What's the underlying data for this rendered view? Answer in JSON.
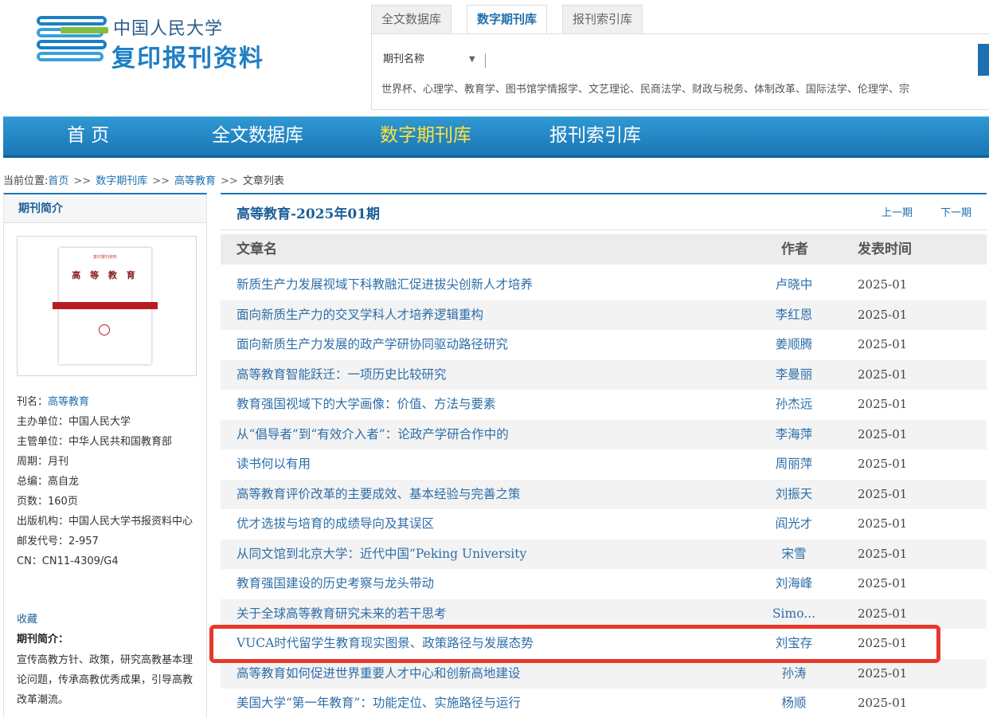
{
  "logo": {
    "line1": "中国人民大学",
    "line2": "复印报刊资料"
  },
  "top_tabs": [
    {
      "label": "全文数据库"
    },
    {
      "label": "数字期刊库"
    },
    {
      "label": "报刊索引库"
    }
  ],
  "search": {
    "select_value": "期刊名称",
    "placeholder": "",
    "hot_words": "世界杯、心理学、教育学、图书馆学情报学、文艺理论、民商法学、财政与税务、体制改革、国际法学、伦理学、宗"
  },
  "nav": [
    {
      "label": "首 页"
    },
    {
      "label": "全文数据库"
    },
    {
      "label": "数字期刊库"
    },
    {
      "label": "报刊索引库"
    }
  ],
  "breadcrumb": {
    "prefix": "当前位置:",
    "home": "首页",
    "sep1": ">>",
    "level1": "数字期刊库",
    "sep2": ">>",
    "level2": "高等教育",
    "sep3": ">>",
    "current": "文章列表"
  },
  "sidebar": {
    "header": "期刊简介",
    "cover": {
      "top": "复印报刊资料",
      "title": "高 等 教 育"
    },
    "info": {
      "name_label": "刊名：",
      "name_value": "高等教育",
      "sponsor": "主办单位：中国人民大学",
      "supervisor": "主管单位：中华人民共和国教育部",
      "cycle": "周期：月刊",
      "editor": "总编：高自龙",
      "pages": "页数：160页",
      "publisher": "出版机构：中国人民大学书报资料中心",
      "postcode": "邮发代号：2-957",
      "cn": "CN：CN11-4309/G4"
    },
    "favorite": "收藏",
    "intro_title": "期刊简介：",
    "intro_text": "宣传高教方针、政策，研究高教基本理论问题，传承高教优秀成果，引导高教改革潮流。"
  },
  "content": {
    "issue_title": "高等教育-2025年01期",
    "prev": "上一期",
    "next": "下一期",
    "headers": {
      "title": "文章名",
      "author": "作者",
      "date": "发表时间"
    },
    "rows": [
      {
        "title": "新质生产力发展视域下科教融汇促进拔尖创新人才培养",
        "author": "卢晓中",
        "date": "2025-01"
      },
      {
        "title": "面向新质生产力的交叉学科人才培养逻辑重构",
        "author": "李红恩",
        "date": "2025-01"
      },
      {
        "title": "面向新质生产力发展的政产学研协同驱动路径研究",
        "author": "姜顺腾",
        "date": "2025-01"
      },
      {
        "title": "高等教育智能跃迁：一项历史比较研究",
        "author": "李曼丽",
        "date": "2025-01"
      },
      {
        "title": "教育强国视域下的大学画像：价值、方法与要素",
        "author": "孙杰远",
        "date": "2025-01"
      },
      {
        "title": "从“倡导者”到“有效介入者”：论政产学研合作中的",
        "author": "李海萍",
        "date": "2025-01"
      },
      {
        "title": "读书何以有用",
        "author": "周丽萍",
        "date": "2025-01"
      },
      {
        "title": "高等教育评价改革的主要成效、基本经验与完善之策",
        "author": "刘振天",
        "date": "2025-01"
      },
      {
        "title": "优才选拔与培育的成绩导向及其误区",
        "author": "阎光才",
        "date": "2025-01"
      },
      {
        "title": "从同文馆到北京大学：近代中国“Peking University",
        "author": "宋雪",
        "date": "2025-01"
      },
      {
        "title": "教育强国建设的历史考察与龙头带动",
        "author": "刘海峰",
        "date": "2025-01"
      },
      {
        "title": "关于全球高等教育研究未来的若干思考",
        "author": "Simo...",
        "date": "2025-01"
      },
      {
        "title": "VUCA时代留学生教育现实图景、政策路径与发展态势",
        "author": "刘宝存",
        "date": "2025-01"
      },
      {
        "title": "高等教育如何促进世界重要人才中心和创新高地建设",
        "author": "孙涛",
        "date": "2025-01"
      },
      {
        "title": "美国大学“第一年教育”：功能定位、实施路径与运行",
        "author": "杨顺",
        "date": "2025-01"
      }
    ]
  },
  "colors": {
    "nav_bg": "#1a77b5",
    "nav_active": "#ffe33a",
    "link": "#2d6ea8",
    "highlight": "#e8382b"
  }
}
